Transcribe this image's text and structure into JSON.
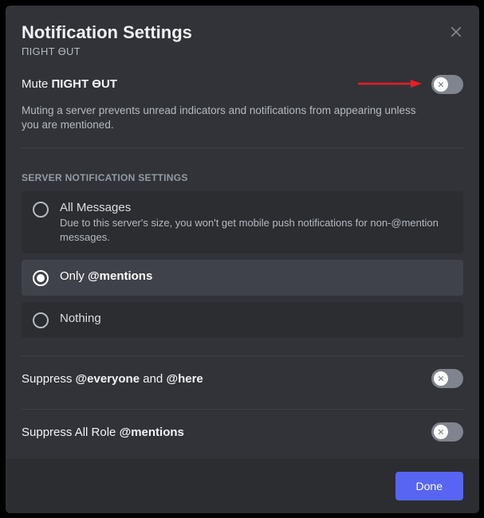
{
  "header": {
    "title": "Notification Settings",
    "subtitle": "ПIGHT ӨUT"
  },
  "mute": {
    "label_prefix": "Mute ",
    "label_server": "ПIGHT ӨUT",
    "description": "Muting a server prevents unread indicators and notifications from appearing unless you are mentioned.",
    "state": false
  },
  "section_label": "SERVER NOTIFICATION SETTINGS",
  "radios": {
    "all": {
      "label": "All Messages",
      "desc": "Due to this server's size, you won't get mobile push notifications for non-@mention messages."
    },
    "only_prefix": "Only ",
    "only_suffix": "@mentions",
    "nothing": "Nothing"
  },
  "suppress_everyone": {
    "prefix": "Suppress ",
    "bold1": "@everyone",
    "mid": " and ",
    "bold2": "@here",
    "state": false
  },
  "suppress_roles": {
    "prefix": "Suppress All Role ",
    "bold": "@mentions",
    "state": false
  },
  "footer": {
    "done": "Done"
  }
}
